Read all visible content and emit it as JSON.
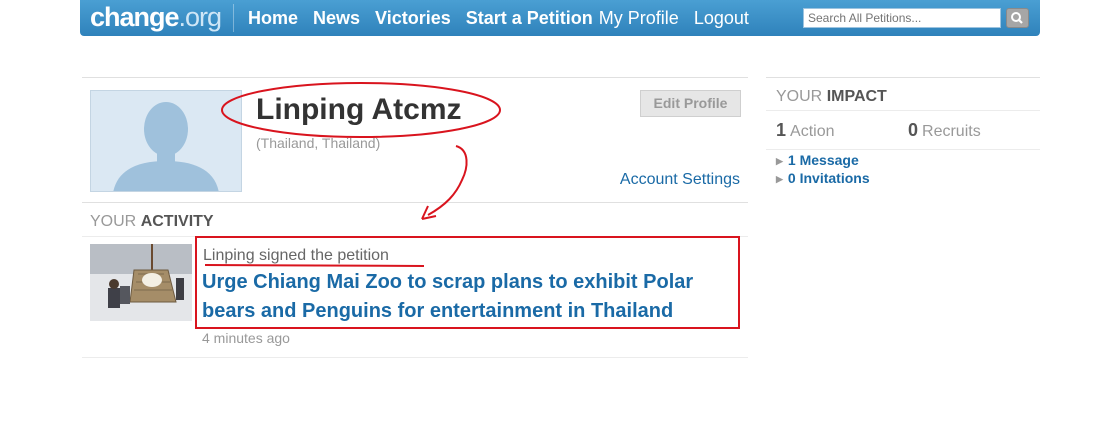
{
  "header": {
    "logo_name": "change",
    "logo_domain": ".org",
    "nav": [
      "Home",
      "News",
      "Victories",
      "Start a Petition",
      "My Profile",
      "Logout"
    ],
    "search_placeholder": "Search All Petitions..."
  },
  "profile": {
    "name": "Linping Atcmz",
    "location": "(Thailand, Thailand)",
    "edit_label": "Edit Profile",
    "account_settings": "Account Settings"
  },
  "activity": {
    "title_light": "YOUR",
    "title_bold": "ACTIVITY",
    "line": "Linping signed the petition",
    "petition_title": "Urge Chiang Mai Zoo to scrap plans to exhibit Polar bears and Penguins for entertainment in Thailand",
    "time": "4 minutes ago"
  },
  "impact": {
    "title_light": "YOUR",
    "title_bold": "IMPACT",
    "actions_count": "1",
    "actions_label": "Action",
    "recruits_count": "0",
    "recruits_label": "Recruits",
    "links": [
      "1 Message",
      "0 Invitations"
    ]
  },
  "colors": {
    "header_blue": "#3a8fc8",
    "link_blue": "#1a6aa6",
    "annotation_red": "#d9141e"
  }
}
